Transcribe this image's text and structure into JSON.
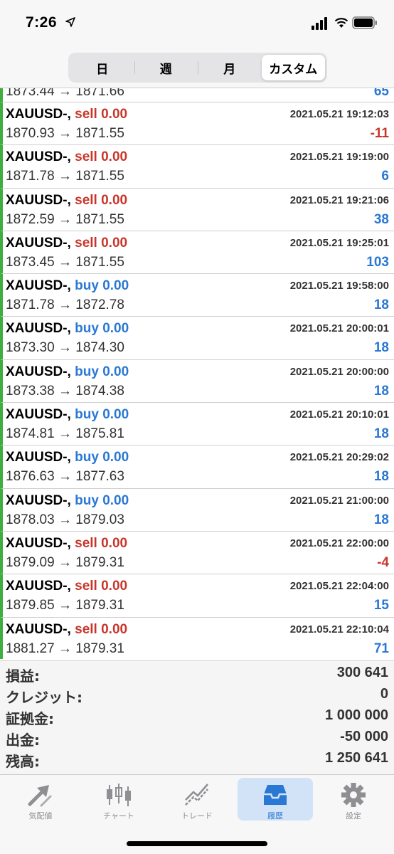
{
  "status_bar": {
    "time": "7:26"
  },
  "header": {
    "segments": [
      "日",
      "週",
      "月",
      "カスタム"
    ],
    "active_segment": "カスタム"
  },
  "partial_row": {
    "open_price": "1873.44",
    "close_price": "1871.66",
    "profit": "65"
  },
  "trades": [
    {
      "symbol": "XAUUSD-,",
      "type": "sell",
      "volume": "0.00",
      "time": "2021.05.21 19:12:03",
      "open_price": "1870.93",
      "close_price": "1871.55",
      "profit": "-11"
    },
    {
      "symbol": "XAUUSD-,",
      "type": "sell",
      "volume": "0.00",
      "time": "2021.05.21 19:19:00",
      "open_price": "1871.78",
      "close_price": "1871.55",
      "profit": "6"
    },
    {
      "symbol": "XAUUSD-,",
      "type": "sell",
      "volume": "0.00",
      "time": "2021.05.21 19:21:06",
      "open_price": "1872.59",
      "close_price": "1871.55",
      "profit": "38"
    },
    {
      "symbol": "XAUUSD-,",
      "type": "sell",
      "volume": "0.00",
      "time": "2021.05.21 19:25:01",
      "open_price": "1873.45",
      "close_price": "1871.55",
      "profit": "103"
    },
    {
      "symbol": "XAUUSD-,",
      "type": "buy",
      "volume": "0.00",
      "time": "2021.05.21 19:58:00",
      "open_price": "1871.78",
      "close_price": "1872.78",
      "profit": "18"
    },
    {
      "symbol": "XAUUSD-,",
      "type": "buy",
      "volume": "0.00",
      "time": "2021.05.21 20:00:01",
      "open_price": "1873.30",
      "close_price": "1874.30",
      "profit": "18"
    },
    {
      "symbol": "XAUUSD-,",
      "type": "buy",
      "volume": "0.00",
      "time": "2021.05.21 20:00:00",
      "open_price": "1873.38",
      "close_price": "1874.38",
      "profit": "18"
    },
    {
      "symbol": "XAUUSD-,",
      "type": "buy",
      "volume": "0.00",
      "time": "2021.05.21 20:10:01",
      "open_price": "1874.81",
      "close_price": "1875.81",
      "profit": "18"
    },
    {
      "symbol": "XAUUSD-,",
      "type": "buy",
      "volume": "0.00",
      "time": "2021.05.21 20:29:02",
      "open_price": "1876.63",
      "close_price": "1877.63",
      "profit": "18"
    },
    {
      "symbol": "XAUUSD-,",
      "type": "buy",
      "volume": "0.00",
      "time": "2021.05.21 21:00:00",
      "open_price": "1878.03",
      "close_price": "1879.03",
      "profit": "18"
    },
    {
      "symbol": "XAUUSD-,",
      "type": "sell",
      "volume": "0.00",
      "time": "2021.05.21 22:00:00",
      "open_price": "1879.09",
      "close_price": "1879.31",
      "profit": "-4"
    },
    {
      "symbol": "XAUUSD-,",
      "type": "sell",
      "volume": "0.00",
      "time": "2021.05.21 22:04:00",
      "open_price": "1879.85",
      "close_price": "1879.31",
      "profit": "15"
    },
    {
      "symbol": "XAUUSD-,",
      "type": "sell",
      "volume": "0.00",
      "time": "2021.05.21 22:10:04",
      "open_price": "1881.27",
      "close_price": "1879.31",
      "profit": "71"
    }
  ],
  "summary": [
    {
      "label": "損益:",
      "value": "300 641"
    },
    {
      "label": "クレジット:",
      "value": "0"
    },
    {
      "label": "証拠金:",
      "value": "1 000 000"
    },
    {
      "label": "出金:",
      "value": "-50 000"
    },
    {
      "label": "残高:",
      "value": "1 250 641"
    }
  ],
  "tabbar": {
    "items": [
      {
        "label": "気配値",
        "icon": "quotes-arrows-icon"
      },
      {
        "label": "チャート",
        "icon": "candlestick-icon"
      },
      {
        "label": "トレード",
        "icon": "trade-line-icon"
      },
      {
        "label": "履歴",
        "icon": "inbox-tray-icon"
      },
      {
        "label": "設定",
        "icon": "gear-icon"
      }
    ],
    "active": "履歴"
  },
  "colors": {
    "sell": "#c8362b",
    "buy": "#2a78d4",
    "profit_positive": "#2a78d4",
    "profit_negative": "#c8362b",
    "row_accent": "#3fae3f",
    "tab_active_bg": "#d3e3f7"
  }
}
